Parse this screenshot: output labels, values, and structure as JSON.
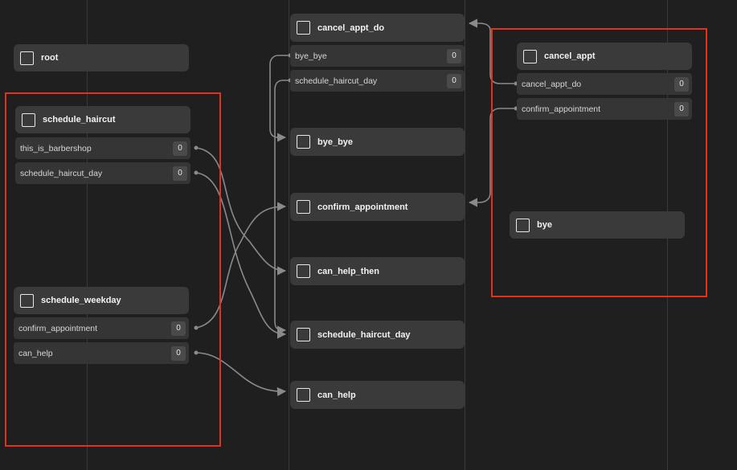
{
  "nodes": {
    "root": "root",
    "schedule_haircut": {
      "title": "schedule_haircut",
      "rows": [
        {
          "label": "this_is_barbershop",
          "count": "0"
        },
        {
          "label": "schedule_haircut_day",
          "count": "0"
        }
      ]
    },
    "schedule_weekday": {
      "title": "schedule_weekday",
      "rows": [
        {
          "label": "confirm_appointment",
          "count": "0"
        },
        {
          "label": "can_help",
          "count": "0"
        }
      ]
    },
    "cancel_appt_do": {
      "title": "cancel_appt_do",
      "rows": [
        {
          "label": "bye_bye",
          "count": "0"
        },
        {
          "label": "schedule_haircut_day",
          "count": "0"
        }
      ]
    },
    "bye_bye": "bye_bye",
    "confirm_appointment": "confirm_appointment",
    "can_help_then": "can_help_then",
    "schedule_haircut_day": "schedule_haircut_day",
    "can_help": "can_help",
    "cancel_appt": {
      "title": "cancel_appt",
      "rows": [
        {
          "label": "cancel_appt_do",
          "count": "0"
        },
        {
          "label": "confirm_appointment",
          "count": "0"
        }
      ]
    },
    "bye": "bye"
  },
  "colors": {
    "highlight": "#e2311d",
    "connector": "#8a8a8a"
  }
}
